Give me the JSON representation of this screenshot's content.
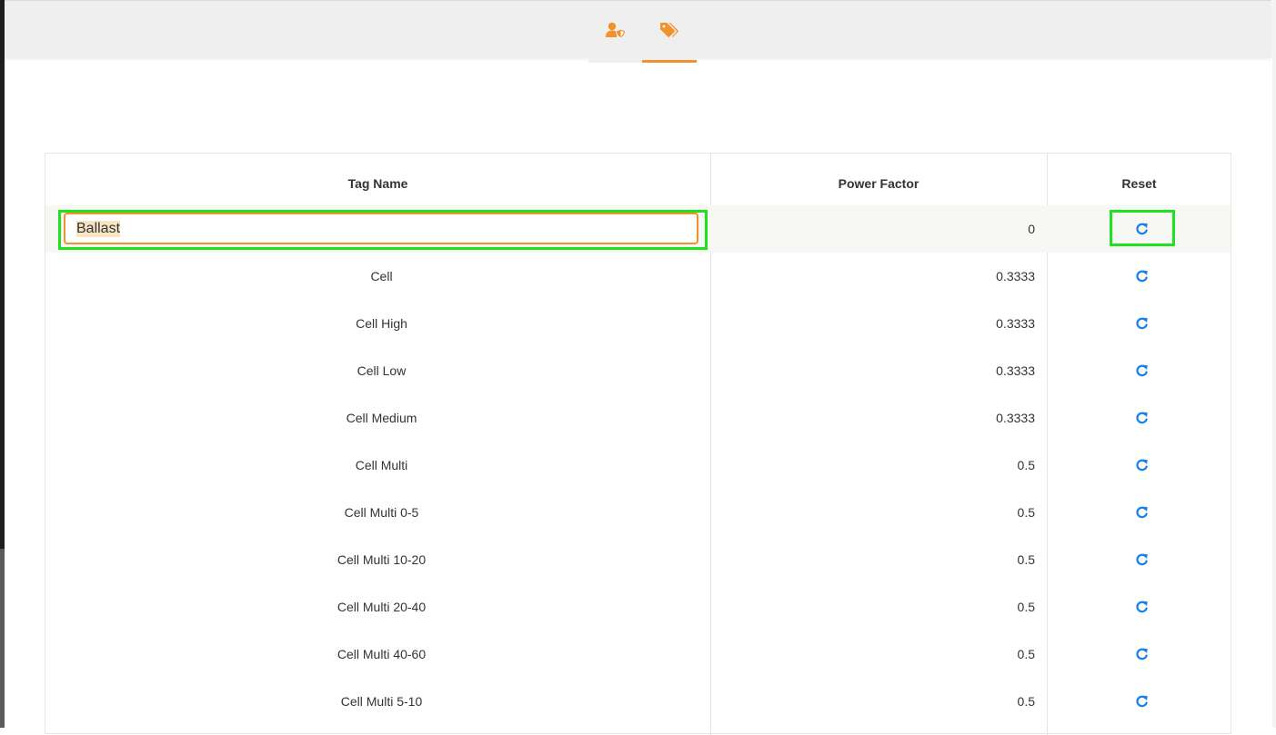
{
  "tabs": [
    {
      "icon": "user-shield-icon",
      "active": false
    },
    {
      "icon": "tags-icon",
      "active": true
    }
  ],
  "colors": {
    "accent": "#f0932b",
    "reset_icon": "#1a7fe8",
    "highlight": "#20e020"
  },
  "table": {
    "columns": [
      "Tag Name",
      "Power Factor",
      "Reset"
    ],
    "rows": [
      {
        "tag": "Ballast",
        "power_factor": "0",
        "editing": true
      },
      {
        "tag": "Cell",
        "power_factor": "0.3333"
      },
      {
        "tag": "Cell High",
        "power_factor": "0.3333"
      },
      {
        "tag": "Cell Low",
        "power_factor": "0.3333"
      },
      {
        "tag": "Cell Medium",
        "power_factor": "0.3333"
      },
      {
        "tag": "Cell Multi",
        "power_factor": "0.5"
      },
      {
        "tag": "Cell Multi 0-5",
        "power_factor": "0.5"
      },
      {
        "tag": "Cell Multi 10-20",
        "power_factor": "0.5"
      },
      {
        "tag": "Cell Multi 20-40",
        "power_factor": "0.5"
      },
      {
        "tag": "Cell Multi 40-60",
        "power_factor": "0.5"
      },
      {
        "tag": "Cell Multi 5-10",
        "power_factor": "0.5"
      }
    ],
    "reset_icon": "refresh-icon"
  }
}
